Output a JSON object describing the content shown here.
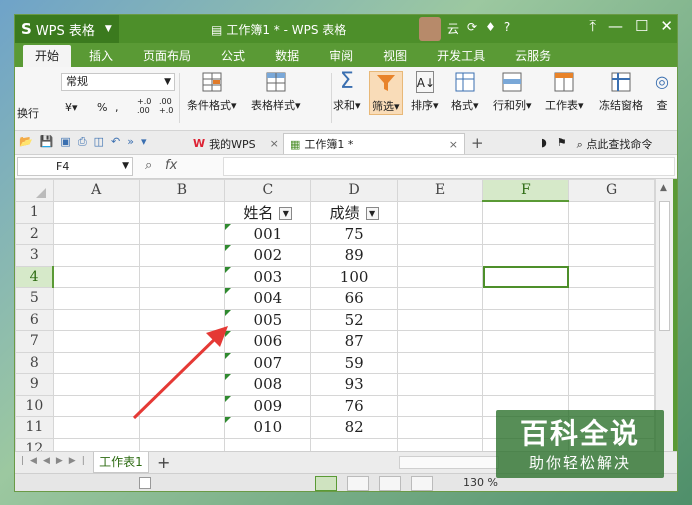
{
  "titlebar": {
    "app_name": "WPS 表格",
    "doc_title": "工作簿1 * - WPS 表格",
    "cloud_label": "云",
    "help_label": "?"
  },
  "ribbon_tabs": [
    "开始",
    "插入",
    "页面布局",
    "公式",
    "数据",
    "审阅",
    "视图",
    "开发工具",
    "云服务"
  ],
  "ribbon": {
    "exec_label": "换行",
    "number_format": "常规",
    "percent": "%",
    "comma": "000",
    "cond_format": "条件格式",
    "table_style": "表格样式",
    "sum": "求和",
    "filter": "筛选",
    "sort": "排序",
    "format": "格式",
    "rows_cols": "行和列",
    "worksheet": "工作表",
    "freeze": "冻结窗格",
    "find": "查"
  },
  "quickbar": {
    "my_wps": "我的WPS",
    "workbook_tab": "工作簿1 *",
    "search_hint": "点此查找命令"
  },
  "formula_bar": {
    "name_box": "F4",
    "fx": "fx"
  },
  "grid": {
    "columns": [
      "A",
      "B",
      "C",
      "D",
      "E",
      "F",
      "G"
    ],
    "rows": [
      {
        "n": "1",
        "c": "姓名",
        "d": "成绩"
      },
      {
        "n": "2",
        "c": "001",
        "d": "75"
      },
      {
        "n": "3",
        "c": "002",
        "d": "89"
      },
      {
        "n": "4",
        "c": "003",
        "d": "100"
      },
      {
        "n": "5",
        "c": "004",
        "d": "66"
      },
      {
        "n": "6",
        "c": "005",
        "d": "52"
      },
      {
        "n": "7",
        "c": "006",
        "d": "87"
      },
      {
        "n": "8",
        "c": "007",
        "d": "59"
      },
      {
        "n": "9",
        "c": "008",
        "d": "93"
      },
      {
        "n": "10",
        "c": "009",
        "d": "76"
      },
      {
        "n": "11",
        "c": "010",
        "d": "82"
      },
      {
        "n": "12",
        "c": "",
        "d": ""
      }
    ],
    "selected_cell": "F4"
  },
  "sheets": [
    "工作表1"
  ],
  "status": {
    "zoom": "130 %"
  },
  "watermark": {
    "title": "百科全说",
    "subtitle": "助你轻松解决"
  },
  "colors": {
    "accent_green": "#4d8f2a",
    "arrow_red": "#e53935"
  }
}
